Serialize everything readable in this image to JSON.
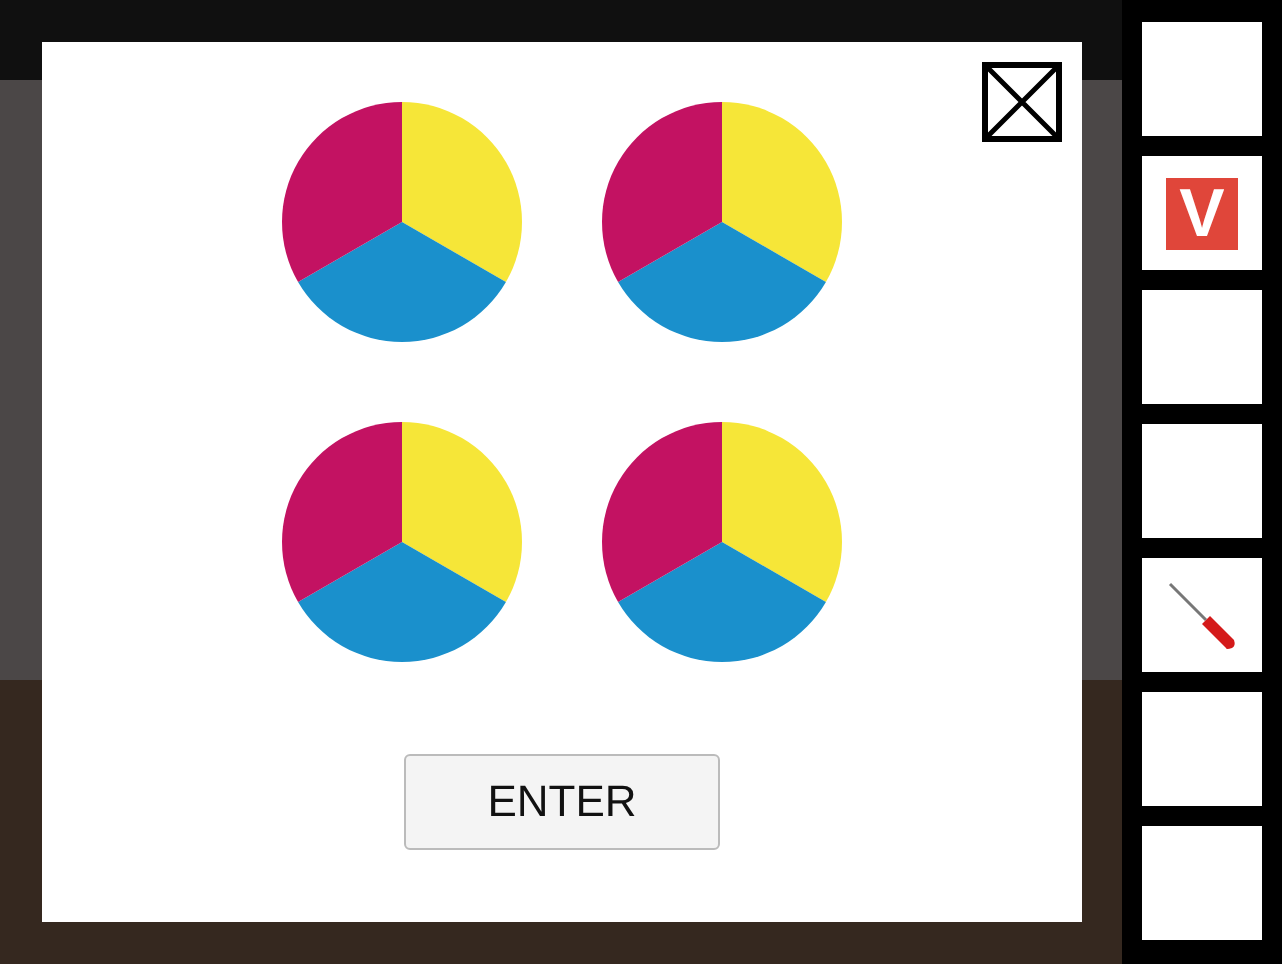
{
  "dials": [
    {
      "segments": [
        {
          "color": "#f6e638"
        },
        {
          "color": "#1a90cc"
        },
        {
          "color": "#c31262"
        }
      ]
    },
    {
      "segments": [
        {
          "color": "#f6e638"
        },
        {
          "color": "#1a90cc"
        },
        {
          "color": "#c31262"
        }
      ]
    },
    {
      "segments": [
        {
          "color": "#f6e638"
        },
        {
          "color": "#1a90cc"
        },
        {
          "color": "#c31262"
        }
      ]
    },
    {
      "segments": [
        {
          "color": "#f6e638"
        },
        {
          "color": "#1a90cc"
        },
        {
          "color": "#c31262"
        }
      ]
    }
  ],
  "button": "ENTER",
  "inventory": [
    {
      "kind": "empty"
    },
    {
      "kind": "letter",
      "text": "V"
    },
    {
      "kind": "empty"
    },
    {
      "kind": "empty"
    },
    {
      "kind": "screwdriver"
    },
    {
      "kind": "empty"
    },
    {
      "kind": "empty"
    }
  ]
}
